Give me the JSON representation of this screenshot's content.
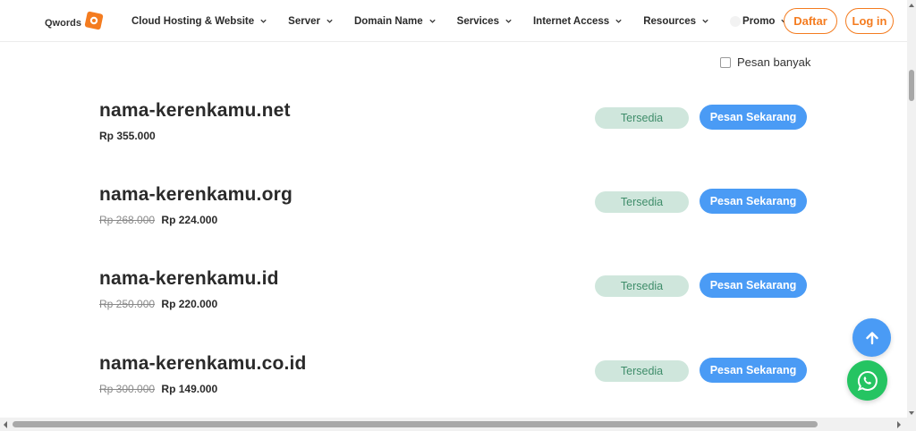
{
  "header": {
    "logo_text": "Qwords",
    "nav": [
      {
        "label": "Cloud Hosting & Website"
      },
      {
        "label": "Server"
      },
      {
        "label": "Domain Name"
      },
      {
        "label": "Services"
      },
      {
        "label": "Internet Access"
      },
      {
        "label": "Resources"
      },
      {
        "label": "Promo"
      }
    ],
    "register_label": "Daftar",
    "login_label": "Log in"
  },
  "bulk_order_label": "Pesan banyak",
  "domains": [
    {
      "name": "nama-kerenkamu.net",
      "old_price": "",
      "price": "Rp 355.000",
      "status": "Tersedia",
      "action": "Pesan Sekarang"
    },
    {
      "name": "nama-kerenkamu.org",
      "old_price": "Rp 268.000",
      "price": "Rp 224.000",
      "status": "Tersedia",
      "action": "Pesan Sekarang"
    },
    {
      "name": "nama-kerenkamu.id",
      "old_price": "Rp 250.000",
      "price": "Rp 220.000",
      "status": "Tersedia",
      "action": "Pesan Sekarang"
    },
    {
      "name": "nama-kerenkamu.co.id",
      "old_price": "Rp 300.000",
      "price": "Rp 149.000",
      "status": "Tersedia",
      "action": "Pesan Sekarang"
    }
  ],
  "icons": {
    "back_to_top": "arrow-up-icon",
    "chat": "whatsapp-icon"
  },
  "colors": {
    "brand_orange": "#f47c20",
    "primary_blue": "#4a9bf5",
    "available_bg": "#cfe6dc",
    "available_text": "#3f8d6a",
    "whatsapp_green": "#25c462"
  }
}
